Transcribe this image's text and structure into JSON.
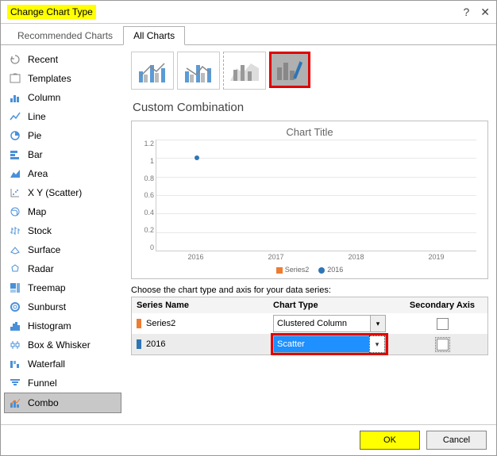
{
  "window": {
    "title": "Change Chart Type"
  },
  "tabs": {
    "recommended": "Recommended Charts",
    "all": "All Charts"
  },
  "sidebar": {
    "items": [
      {
        "label": "Recent"
      },
      {
        "label": "Templates"
      },
      {
        "label": "Column"
      },
      {
        "label": "Line"
      },
      {
        "label": "Pie"
      },
      {
        "label": "Bar"
      },
      {
        "label": "Area"
      },
      {
        "label": "X Y (Scatter)"
      },
      {
        "label": "Map"
      },
      {
        "label": "Stock"
      },
      {
        "label": "Surface"
      },
      {
        "label": "Radar"
      },
      {
        "label": "Treemap"
      },
      {
        "label": "Sunburst"
      },
      {
        "label": "Histogram"
      },
      {
        "label": "Box & Whisker"
      },
      {
        "label": "Waterfall"
      },
      {
        "label": "Funnel"
      },
      {
        "label": "Combo"
      }
    ]
  },
  "section": {
    "title": "Custom Combination"
  },
  "chart_data": {
    "type": "scatter",
    "title": "Chart Title",
    "y_ticks": [
      "1.2",
      "1",
      "0.8",
      "0.6",
      "0.4",
      "0.2",
      "0"
    ],
    "x_ticks": [
      "2016",
      "2017",
      "2018",
      "2019"
    ],
    "series": [
      {
        "name": "Series2",
        "color": "#ed7d31",
        "values": []
      },
      {
        "name": "2016",
        "color": "#2e75b6",
        "points": [
          {
            "x": 1,
            "y": 1
          }
        ]
      }
    ],
    "ylim": [
      0,
      1.2
    ]
  },
  "series_table": {
    "caption": "Choose the chart type and axis for your data series:",
    "headers": {
      "name": "Series Name",
      "type": "Chart Type",
      "axis": "Secondary Axis"
    },
    "rows": [
      {
        "swatch": "#ed7d31",
        "name": "Series2",
        "type": "Clustered Column",
        "secondary": false
      },
      {
        "swatch": "#2e75b6",
        "name": "2016",
        "type": "Scatter",
        "secondary": false
      }
    ]
  },
  "buttons": {
    "ok": "OK",
    "cancel": "Cancel"
  }
}
